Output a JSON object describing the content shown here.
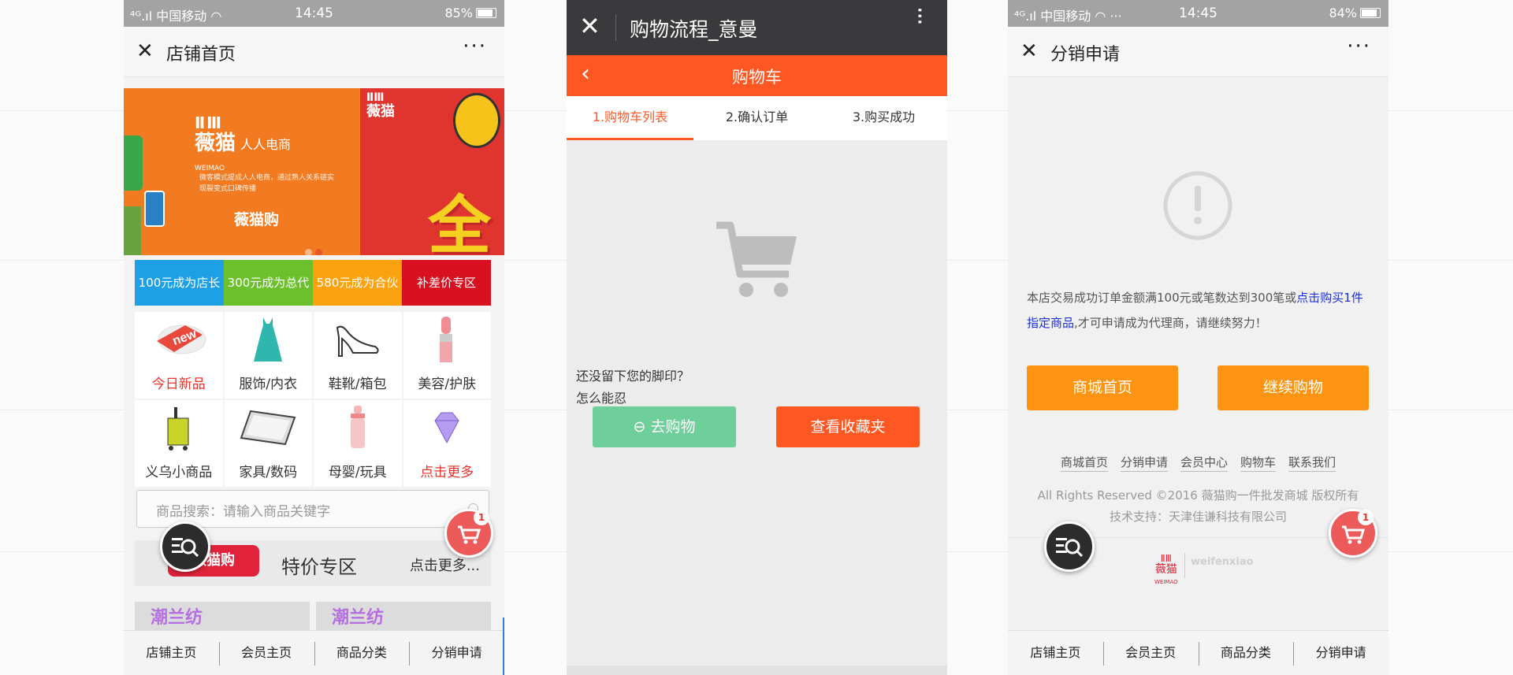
{
  "phone1": {
    "status": {
      "carrier": "中国移动",
      "time": "14:45",
      "battery": "85%"
    },
    "nav_title": "店铺首页",
    "banner": {
      "brand": "薇猫",
      "brand_en": "WEIMAO",
      "slogan": "人人电商",
      "desc_line1": "微客模式提成人人电商，通过熟人关系链实",
      "desc_line2": "现裂变式口碑传播",
      "name": "薇猫购",
      "right_text": "全"
    },
    "promos": [
      {
        "label": "100元成为店长",
        "color": "#1ea0e6"
      },
      {
        "label": "300元成为总代",
        "color": "#6cc02c"
      },
      {
        "label": "580元成为合伙",
        "color": "#fca20f"
      },
      {
        "label": "补差价专区",
        "color": "#d8101f"
      }
    ],
    "categories": [
      {
        "label": "今日新品",
        "icon": "new-tag-icon"
      },
      {
        "label": "服饰/内衣",
        "icon": "dress-icon"
      },
      {
        "label": "鞋靴/箱包",
        "icon": "high-heel-icon"
      },
      {
        "label": "美容/护肤",
        "icon": "lipstick-icon"
      },
      {
        "label": "义乌小商品",
        "icon": "luggage-icon"
      },
      {
        "label": "家具/数码",
        "icon": "tablet-icon"
      },
      {
        "label": "母婴/玩具",
        "icon": "bottle-icon"
      },
      {
        "label": "点击更多",
        "icon": "diamond-icon"
      }
    ],
    "search_placeholder": "商品搜索：请输入商品关键字",
    "special": {
      "tag": "薇猫购",
      "title": "特价专区",
      "more": "点击更多..."
    },
    "products": [
      "潮兰纺",
      "潮兰纺"
    ],
    "cart_badge": "1",
    "tabs": [
      "店铺主页",
      "会员主页",
      "商品分类",
      "分销申请"
    ]
  },
  "phone2": {
    "title": "购物流程_意曼",
    "bar_title": "购物车",
    "steps": [
      "1.购物车列表",
      "2.确认订单",
      "3.购买成功"
    ],
    "empty_line1": "还没留下您的脚印？",
    "empty_line2": "怎么能忍",
    "go_shopping": "去购物",
    "favorites": "查看收藏夹"
  },
  "phone3": {
    "status": {
      "carrier": "中国移动",
      "time": "14:45",
      "battery": "84%"
    },
    "nav_title": "分销申请",
    "message_before": "本店交易成功订单金额满100元或笔数达到300笔或",
    "message_link": "点击购买1件指定商品",
    "message_after": ",才可申请成为代理商，请继续努力！",
    "btn_home": "商城首页",
    "btn_continue": "继续购物",
    "links": [
      "商城首页",
      "分销申请",
      "会员中心",
      "购物车",
      "联系我们"
    ],
    "copyright": "All Rights Reserved ©2016 薇猫购一件批发商城 版权所有",
    "tech_support": "技术支持：天津佳谦科技有限公司",
    "footer_brand": "薇猫",
    "footer_brand_en": "WEIMAO",
    "footer_partner": "weifenxiao",
    "cart_badge": "1",
    "tabs": [
      "店铺主页",
      "会员主页",
      "商品分类",
      "分销申请"
    ]
  }
}
